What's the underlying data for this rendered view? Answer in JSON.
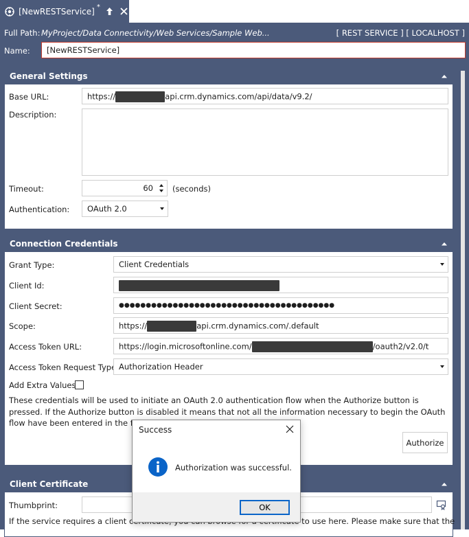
{
  "tab": {
    "title": "[NewRESTService]",
    "modified_marker": "*",
    "icons": [
      "service-gear-icon",
      "pin-icon",
      "close-icon"
    ]
  },
  "header": {
    "full_path_label": "Full Path:",
    "full_path_value": "MyProject/Data Connectivity/Web Services/Sample Web...",
    "right_info": "[ REST SERVICE ] [ LOCALHOST ]",
    "name_label": "Name:",
    "name_value": "[NewRESTService]"
  },
  "general": {
    "title": "General Settings",
    "base_url_label": "Base URL:",
    "base_url_prefix": "https://",
    "base_url_suffix": "api.crm.dynamics.com/api/data/v9.2/",
    "description_label": "Description:",
    "description_value": "",
    "timeout_label": "Timeout:",
    "timeout_value": "60",
    "timeout_unit": "(seconds)",
    "auth_label": "Authentication:",
    "auth_value": "OAuth 2.0"
  },
  "credentials": {
    "title": "Connection Credentials",
    "grant_type_label": "Grant Type:",
    "grant_type_value": "Client Credentials",
    "client_id_label": "Client Id:",
    "client_secret_label": "Client Secret:",
    "client_secret_value": "●●●●●●●●●●●●●●●●●●●●●●●●●●●●●●●●●●●●●●●●",
    "scope_label": "Scope:",
    "scope_prefix": "https://",
    "scope_suffix": "api.crm.dynamics.com/.default",
    "token_url_label": "Access Token URL:",
    "token_url_prefix": "https://login.microsoftonline.com/",
    "token_url_suffix": "/oauth2/v2.0/t",
    "token_request_type_label": "Access Token Request Type:",
    "token_request_type_value": "Authorization Header",
    "extra_values_label": "Add Extra Values",
    "extra_values_checked": false,
    "info_text": "These credentials will be used to initiate an OAuth 2.0 authentication flow when the Authorize button is pressed. If the Authorize button is disabled it means that not all the information necessary to begin the OAuth flow have been entered in the form above.",
    "authorize_label": "Authorize"
  },
  "certificate": {
    "title": "Client Certificate",
    "thumbprint_label": "Thumbprint:",
    "thumbprint_value": "",
    "help_text": "If the service requires a client certificate, you can browse for a certificate to use here. Please make sure that the"
  },
  "dialog": {
    "title": "Success",
    "message": "Authorization was successful.",
    "ok_label": "OK",
    "icon": "info-icon"
  },
  "colors": {
    "chrome": "#4b5a7a",
    "name_border": "#c0392b",
    "info_icon": "#0a64c8",
    "ok_border": "#0a64c8"
  }
}
